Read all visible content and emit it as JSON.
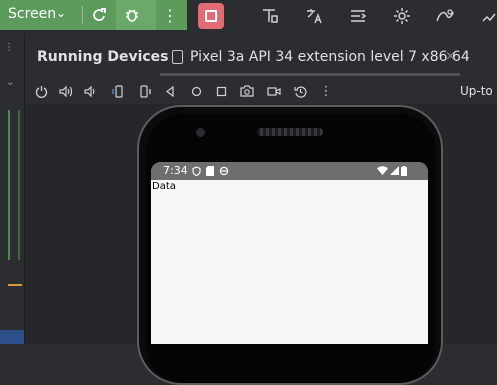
{
  "toolbar": {
    "run_config_label": "Screen",
    "chevron": "⌄",
    "more": "⋮"
  },
  "panel": {
    "title": "Running Devices",
    "device_tab_label": "Pixel 3a API 34 extension level 7 x86 64",
    "close": "×"
  },
  "controls": {
    "up_to_date_label": "Up-to"
  },
  "device_screen": {
    "status_time": "7:34",
    "app_text": "Data"
  },
  "colors": {
    "run_green": "#5d9b5c",
    "stop_red": "#e06c75",
    "ide_bg": "#2b2d30"
  }
}
